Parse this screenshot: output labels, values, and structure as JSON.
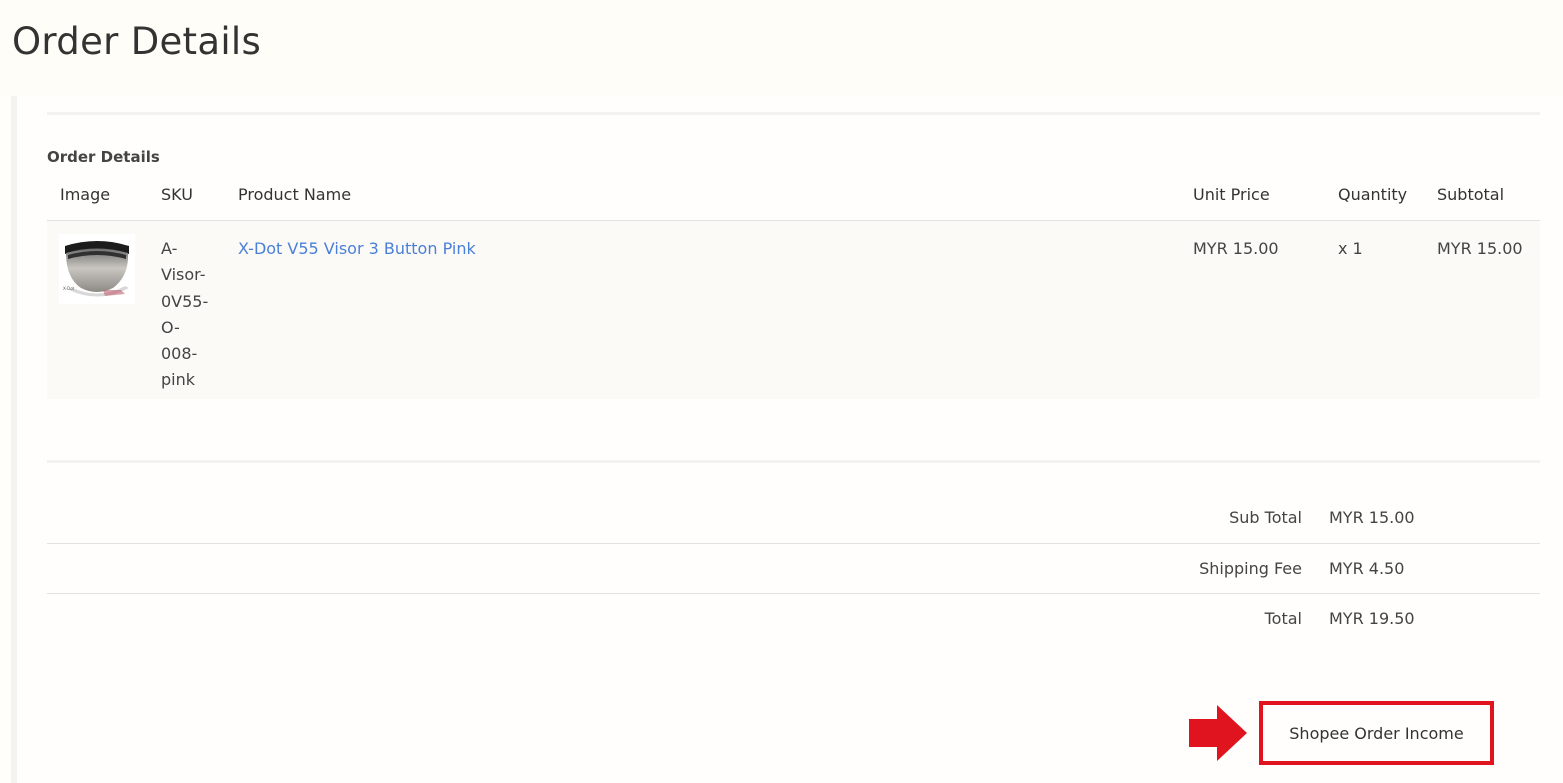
{
  "page": {
    "title": "Order Details"
  },
  "order": {
    "section_title": "Order Details",
    "columns": {
      "image": "Image",
      "sku": "SKU",
      "product_name": "Product Name",
      "unit_price": "Unit Price",
      "quantity": "Quantity",
      "subtotal": "Subtotal"
    },
    "items": [
      {
        "image_icon": "helmet-visor-image",
        "sku_lines": [
          "A-",
          "Visor-",
          "0V55-",
          "O-",
          "008-",
          "pink"
        ],
        "product_name": "X-Dot V55 Visor 3 Button Pink",
        "unit_price": "MYR 15.00",
        "quantity": "x 1",
        "subtotal": "MYR 15.00"
      }
    ]
  },
  "totals": {
    "sub_total_label": "Sub Total",
    "sub_total_value": "MYR 15.00",
    "shipping_label": "Shipping Fee",
    "shipping_value": "MYR 4.50",
    "total_label": "Total",
    "total_value": "MYR 19.50"
  },
  "actions": {
    "shopee_income_label": "Shopee Order Income"
  },
  "colors": {
    "accent_red": "#e0141e",
    "link_blue": "#4a7fd8"
  }
}
